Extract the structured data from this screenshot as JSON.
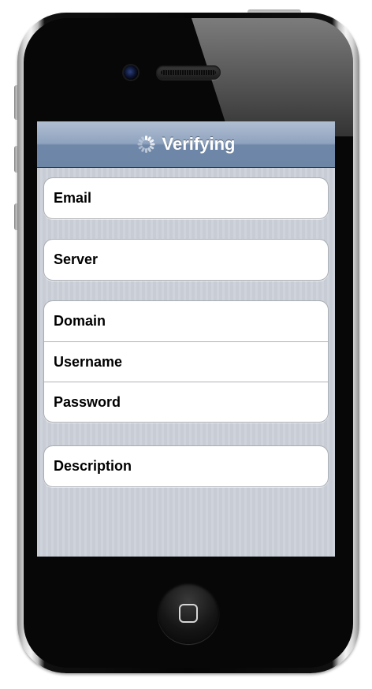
{
  "navbar": {
    "title": "Verifying",
    "spinner_icon": "activity-spinner-icon"
  },
  "form": {
    "groups": [
      {
        "cells": [
          {
            "label": "Email"
          }
        ]
      },
      {
        "cells": [
          {
            "label": "Server"
          }
        ]
      },
      {
        "cells": [
          {
            "label": "Domain"
          },
          {
            "label": "Username"
          },
          {
            "label": "Password"
          }
        ]
      },
      {
        "cells": [
          {
            "label": "Description"
          }
        ]
      }
    ]
  },
  "device": {
    "home_button_icon": "home-square-icon",
    "colors": {
      "navbar": "#8fa3bf",
      "background": "#c7ccd5",
      "cell_background": "#ffffff",
      "bezel": "#070707"
    }
  }
}
